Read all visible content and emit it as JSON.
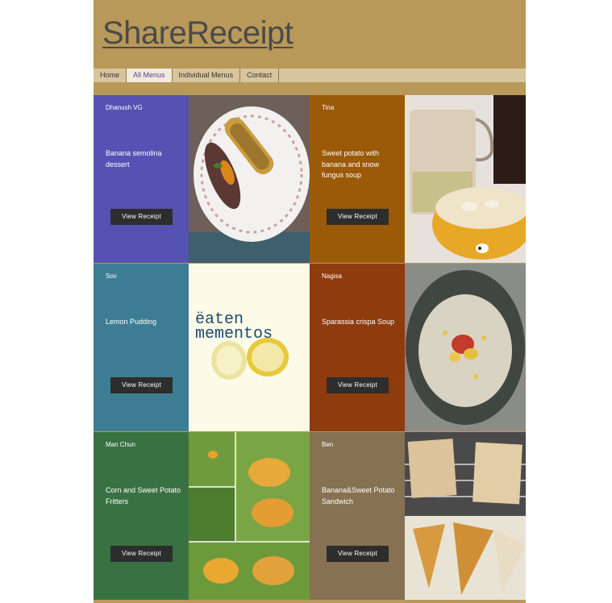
{
  "site": {
    "title": "ShareReceipt"
  },
  "nav": {
    "items": [
      "Home",
      "All Menus",
      "Individual Menus",
      "Contact"
    ],
    "active": "All Menus"
  },
  "cards": [
    {
      "author": "Dhanush VG",
      "dish": "Banana semolina dessert",
      "button": "View Receipt",
      "color": "#5652b4"
    },
    {
      "author": "Tina",
      "dish": "Sweet potato with banana and snow fungus soup",
      "button": "View Receipt",
      "color": "#9b5a07"
    },
    {
      "author": "Sov",
      "dish": "Lemon Pudding",
      "button": "View Receipt",
      "color": "#3d7d93"
    },
    {
      "author": "Nagisa",
      "dish": "Sparassia crispa Soup",
      "button": "View Receipt",
      "color": "#8e3b0e"
    },
    {
      "author": "Man Chun",
      "dish": "Corn and Sweet Potato Fritters",
      "button": "View Receipt",
      "color": "#397242"
    },
    {
      "author": "Ben",
      "dish": "Banana&Sweet Potato Sandwich",
      "button": "View Receipt",
      "color": "#867152"
    }
  ],
  "photo_text": {
    "line1": "ëaten",
    "line2": "mementos"
  }
}
